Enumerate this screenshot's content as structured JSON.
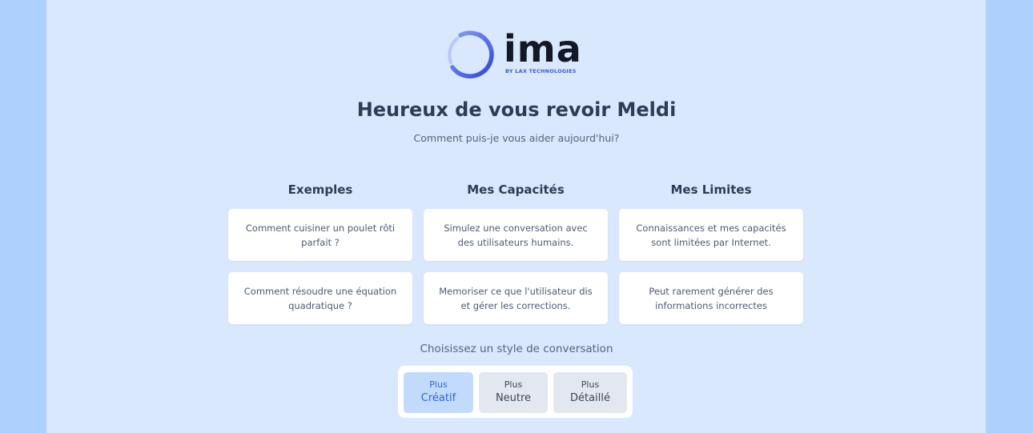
{
  "brand": {
    "name": "ima",
    "tagline": "BY LAX TECHNOLOGIES",
    "logo_icon": "ring-icon",
    "colors": {
      "page_bg": "#aed0fc",
      "panel_bg": "#d9e8fd",
      "accent": "#2f63d6",
      "ring_start": "#8a9ff0",
      "ring_end": "#2c46d8"
    }
  },
  "header": {
    "title": "Heureux de vous revoir Meldi",
    "subtitle": "Comment puis-je vous aider aujourd'hui?"
  },
  "columns": [
    {
      "title": "Exemples",
      "cards": [
        "Comment cuisiner un poulet rôti parfait ?",
        "Comment résoudre une équation quadratique ?"
      ]
    },
    {
      "title": "Mes Capacités",
      "cards": [
        "Simulez une conversation avec des utilisateurs humains.",
        "Memoriser ce que l'utilisateur dis et gérer les corrections."
      ]
    },
    {
      "title": "Mes Limites",
      "cards": [
        "Connaissances et mes capacités sont limitées par Internet.",
        "Peut rarement générer des informations incorrectes"
      ]
    }
  ],
  "conversation_style": {
    "label": "Choisissez un style de conversation",
    "selected": "Créatif",
    "options": [
      {
        "line1": "Plus",
        "line2": "Créatif"
      },
      {
        "line1": "Plus",
        "line2": "Neutre"
      },
      {
        "line1": "Plus",
        "line2": "Détaillé"
      }
    ]
  }
}
